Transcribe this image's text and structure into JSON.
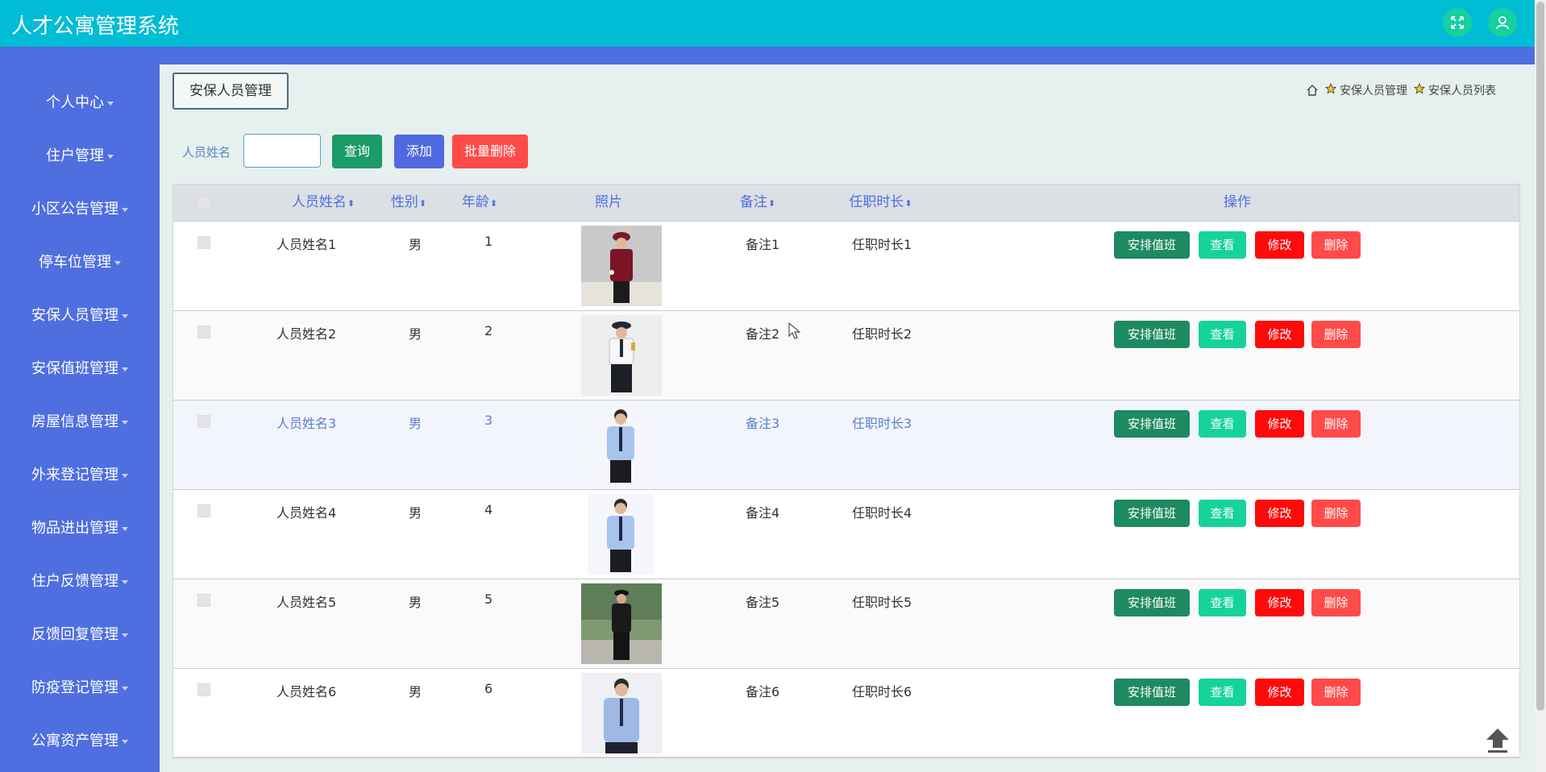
{
  "app": {
    "title": "人才公寓管理系统"
  },
  "sidebar": {
    "items": [
      {
        "label": "个人中心"
      },
      {
        "label": "住户管理"
      },
      {
        "label": "小区公告管理"
      },
      {
        "label": "停车位管理"
      },
      {
        "label": "安保人员管理"
      },
      {
        "label": "安保值班管理"
      },
      {
        "label": "房屋信息管理"
      },
      {
        "label": "外来登记管理"
      },
      {
        "label": "物品进出管理"
      },
      {
        "label": "住户反馈管理"
      },
      {
        "label": "反馈回复管理"
      },
      {
        "label": "防疫登记管理"
      },
      {
        "label": "公寓资产管理"
      }
    ]
  },
  "page": {
    "title": "安保人员管理",
    "breadcrumb": [
      "安保人员管理",
      "安保人员列表"
    ]
  },
  "search": {
    "label": "人员姓名",
    "value": "",
    "query_label": "查询",
    "add_label": "添加",
    "batch_delete_label": "批量删除"
  },
  "table": {
    "columns": {
      "name": "人员姓名",
      "gender": "性别",
      "age": "年龄",
      "photo": "照片",
      "remark": "备注",
      "tenure": "任职时长",
      "actions": "操作"
    },
    "rows": [
      {
        "name": "人员姓名1",
        "gender": "男",
        "age": "1",
        "remark": "备注1",
        "tenure": "任职时长1"
      },
      {
        "name": "人员姓名2",
        "gender": "男",
        "age": "2",
        "remark": "备注2",
        "tenure": "任职时长2"
      },
      {
        "name": "人员姓名3",
        "gender": "男",
        "age": "3",
        "remark": "备注3",
        "tenure": "任职时长3"
      },
      {
        "name": "人员姓名4",
        "gender": "男",
        "age": "4",
        "remark": "备注4",
        "tenure": "任职时长4"
      },
      {
        "name": "人员姓名5",
        "gender": "男",
        "age": "5",
        "remark": "备注5",
        "tenure": "任职时长5"
      },
      {
        "name": "人员姓名6",
        "gender": "男",
        "age": "6",
        "remark": "备注6",
        "tenure": "任职时长6"
      }
    ],
    "row_actions": {
      "arrange": "安排值班",
      "view": "查看",
      "edit": "修改",
      "delete": "删除"
    }
  },
  "icons": {
    "fullscreen": "fullscreen-icon",
    "user": "user-icon",
    "home": "home-icon",
    "star": "star-icon",
    "to_top": "arrow-up-icon"
  },
  "colors": {
    "header": "#00bcd4",
    "sidebar": "#4f6fe0",
    "accent": "#4f6fe0",
    "danger": "#ff0a0a"
  }
}
